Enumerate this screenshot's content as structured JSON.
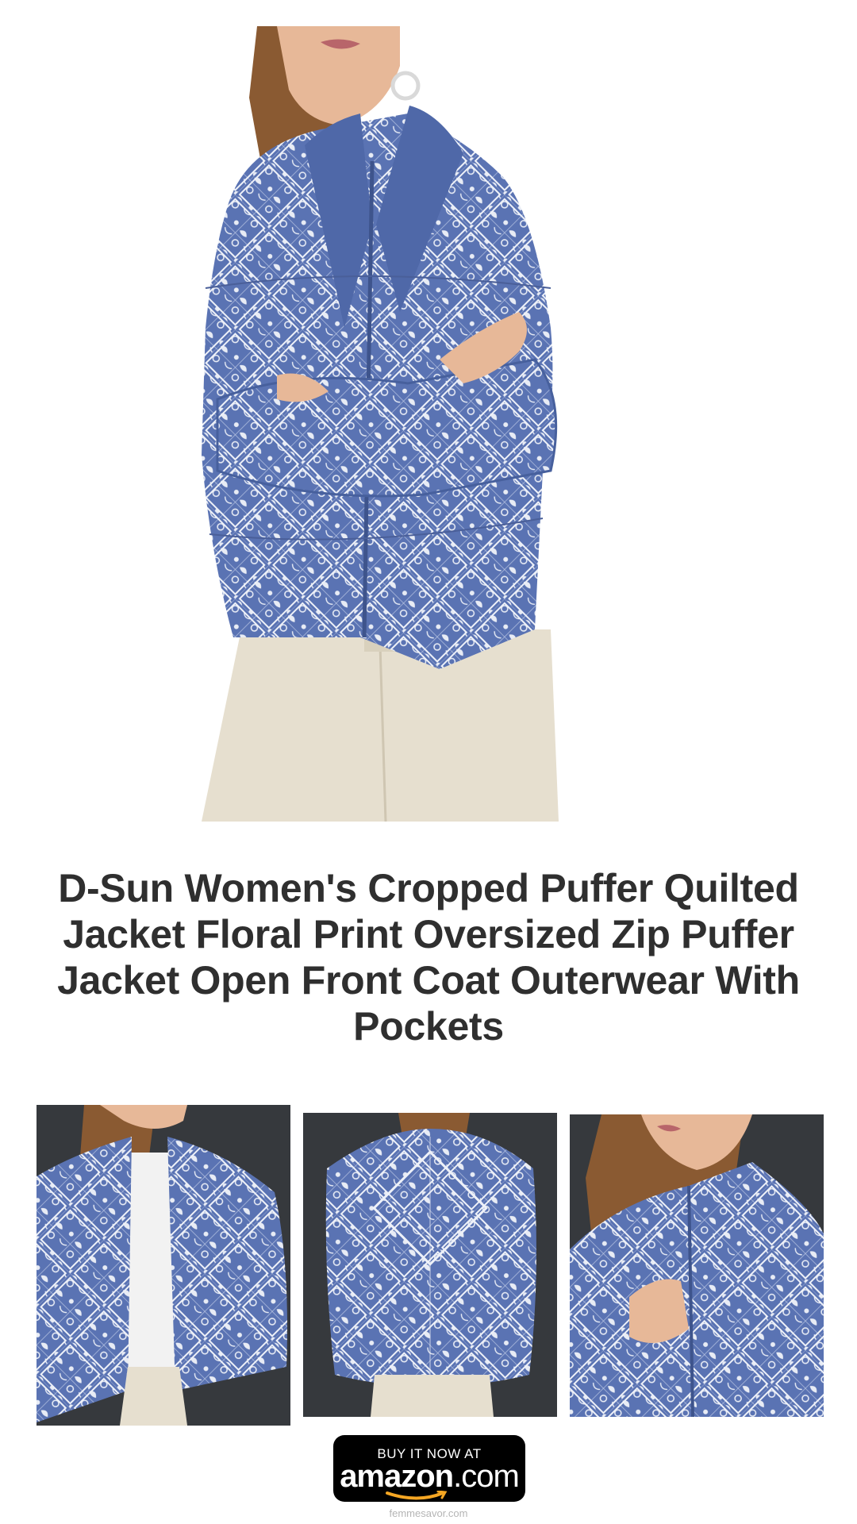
{
  "product": {
    "title": "D-Sun Women's Cropped Puffer Quilted Jacket Floral Print Oversized Zip Puffer Jacket Open Front Coat Outerwear With Pockets"
  },
  "images": {
    "hero": "model-wearing-blue-paisley-puffer-jacket-arms-crossed",
    "thumbnails": [
      "front-view-open-jacket",
      "back-view-jacket",
      "close-up-collar-zip"
    ]
  },
  "buy_button": {
    "top_label": "BUY IT NOW AT",
    "brand_main": "amazon",
    "brand_suffix": ".com"
  },
  "footer": {
    "site": "femmesavor.com"
  },
  "colors": {
    "jacket_blue": "#5a73b3",
    "pattern_white": "#e8ecf5",
    "pants_cream": "#e6dfcf",
    "thumb_background": "#36393d",
    "title_text": "#2f2f2f",
    "amazon_smile": "#f5a623"
  }
}
